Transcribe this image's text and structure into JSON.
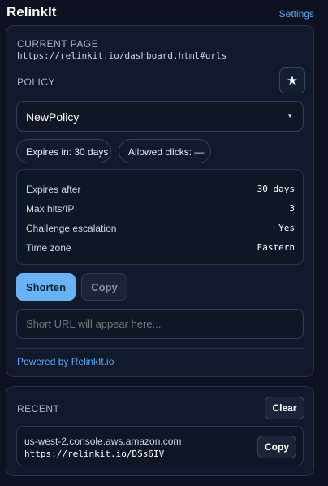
{
  "header": {
    "title": "RelinkIt",
    "settings_label": "Settings"
  },
  "current_page": {
    "label": "CURRENT PAGE",
    "url": "https://relinkit.io/dashboard.html#urls"
  },
  "policy": {
    "label": "POLICY",
    "star_icon": "★",
    "selected": "NewPolicy",
    "caret_icon": "▼",
    "pills": {
      "expires": "Expires in: 30 days",
      "clicks": "Allowed clicks: —"
    },
    "details": [
      {
        "key": "Expires after",
        "value": "30 days"
      },
      {
        "key": "Max hits/IP",
        "value": "3"
      },
      {
        "key": "Challenge escalation",
        "value": "Yes"
      },
      {
        "key": "Time zone",
        "value": "Eastern"
      }
    ]
  },
  "actions": {
    "shorten_label": "Shorten",
    "copy_label": "Copy",
    "short_url_placeholder": "Short URL will appear here..."
  },
  "footer": {
    "powered_by": "Powered by RelinkIt.io"
  },
  "recent": {
    "label": "RECENT",
    "clear_label": "Clear",
    "items": [
      {
        "host": "us-west-2.console.aws.amazon.com",
        "short_url": "https://relinkit.io/DSs6IV",
        "copy_label": "Copy"
      }
    ]
  },
  "colors": {
    "accent": "#5aa9ef",
    "primary_button": "#69b3f2",
    "background": "#0c1220",
    "card": "#111a2c"
  }
}
